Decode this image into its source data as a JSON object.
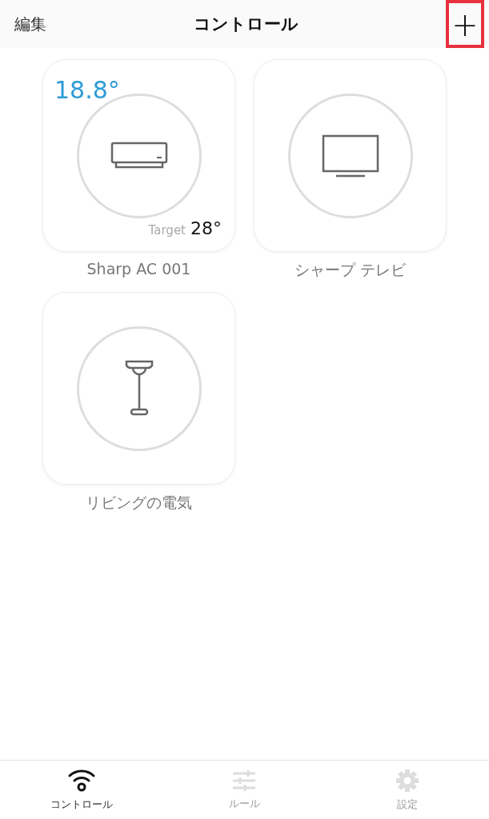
{
  "header": {
    "edit": "編集",
    "title": "コントロール",
    "add": {
      "label": "+",
      "highlighted": true
    }
  },
  "devices": [
    {
      "kind": "ac",
      "name": "Sharp AC 001",
      "current_temp": "18.8°",
      "target_label": "Target",
      "target_temp": "28°"
    },
    {
      "kind": "tv",
      "name": "シャープ テレビ"
    },
    {
      "kind": "lamp",
      "name": "リビングの電気"
    }
  ],
  "tabs": [
    {
      "kind": "wifi",
      "label": "コントロール",
      "selected": true
    },
    {
      "kind": "sliders",
      "label": "ルール",
      "selected": false
    },
    {
      "kind": "gear",
      "label": "設定",
      "selected": false
    }
  ]
}
